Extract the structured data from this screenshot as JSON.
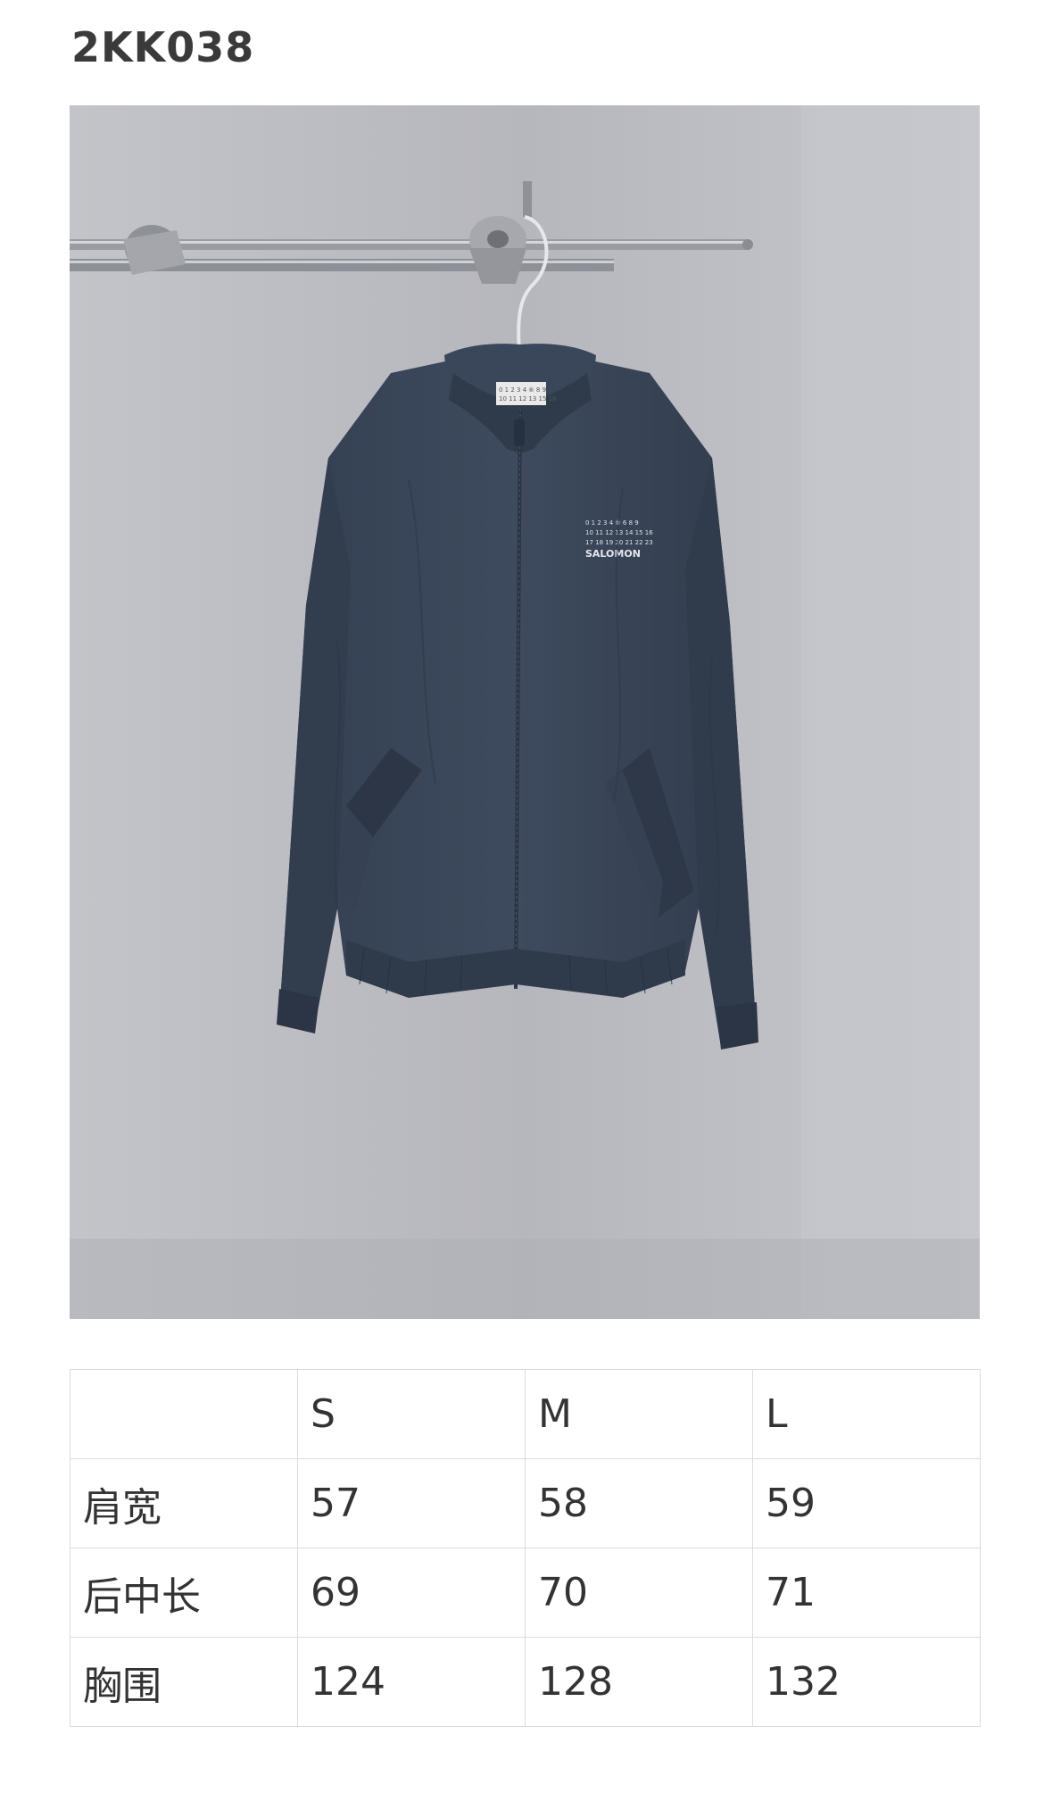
{
  "title": "2KK038",
  "photo": {
    "subject": "jacket-photo",
    "label_text": "SALOMON",
    "colors": {
      "jacket": "#3b4658",
      "background": "#b9bac0",
      "rod": "#9a9ca3"
    }
  },
  "size_table": {
    "headers": [
      "",
      "S",
      "M",
      "L"
    ],
    "rows": [
      {
        "label": "肩宽",
        "values": [
          "57",
          "58",
          "59"
        ]
      },
      {
        "label": "后中长",
        "values": [
          "69",
          "70",
          "71"
        ]
      },
      {
        "label": "胸围",
        "values": [
          "124",
          "128",
          "132"
        ]
      }
    ]
  },
  "colors": {
    "title": "#3a3a3a",
    "border": "#dcdcdc",
    "text": "#333333"
  }
}
